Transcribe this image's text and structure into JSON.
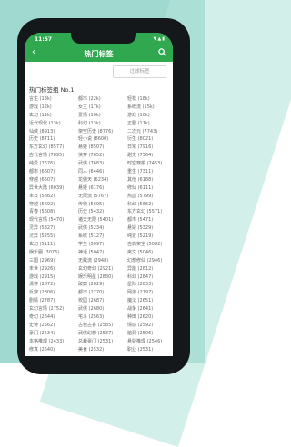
{
  "status": {
    "time": "11:57"
  },
  "appbar": {
    "title": "热门标签"
  },
  "filter": {
    "placeholder": "过滤标签"
  },
  "group": {
    "title": "热门标签组 No.1"
  },
  "tags": [
    [
      "言生 (13k)",
      "都市 (22k)",
      "轻松 (18k)"
    ],
    [
      "游戏 (12k)",
      "女主 (17k)",
      "系统流 (15k)"
    ],
    [
      "玄幻 (11k)",
      "爱情 (10k)",
      "游戏 (10k)"
    ],
    [
      "近代现代 (13k)",
      "科幻 (13k)",
      "正剧 (11k)"
    ],
    [
      "仙侠 (8913)",
      "架空历史 (8776)",
      "二次元 (7743)"
    ],
    [
      "历史 (8711)",
      "轻小说 (8600)",
      "衍生 (8021)"
    ],
    [
      "东方玄幻 (8577)",
      "悬疑 (8507)",
      "日常 (7916)"
    ],
    [
      "古代言情 (7895)",
      "快穿 (7652)",
      "甜文 (7564)"
    ],
    [
      "纯爱 (7676)",
      "武侠 (7683)",
      "时空穿梭 (7453)"
    ],
    [
      "都市 (6607)",
      "同人 (6446)",
      "重生 (7311)"
    ],
    [
      "穿越 (6507)",
      "龙傲天 (6234)",
      "其他 (6188)"
    ],
    [
      "异世大陆 (6039)",
      "悬疑 (6176)",
      "修仙 (6111)"
    ],
    [
      "末日 (5882)",
      "无限流 (5767)",
      "热血 (5799)"
    ],
    [
      "穿越 (5692)",
      "传统 (5695)",
      "科幻 (5662)"
    ],
    [
      "青春 (5608)",
      "历史 (5432)",
      "东方玄幻 (5571)"
    ],
    [
      "现代言情 (5470)",
      "诸天无限 (5401)",
      "都市 (5471)"
    ],
    [
      "灵异 (5327)",
      "武侠 (5234)",
      "悬疑 (5329)"
    ],
    [
      "灵异 (5255)",
      "系统 (5127)",
      "纯爱 (5219)"
    ],
    [
      "玄幻 (5111)",
      "学生 (5097)",
      "古典架空 (5082)"
    ],
    [
      "娱乐圈 (3076)",
      "神话 (5047)",
      "爽文 (5046)"
    ],
    [
      "三国 (2969)",
      "无敌流 (2948)",
      "幻想修仙 (2946)"
    ],
    [
      "末世 (2926)",
      "玄幻奇幻 (2921)",
      "异能 (2812)"
    ],
    [
      "游戏 (2915)",
      "娱乐明星 (2880)",
      "科幻 (2847)"
    ],
    [
      "清穿 (2872)",
      "破案 (2829)",
      "星际 (2833)"
    ],
    [
      "反穿 (2806)",
      "都市 (2770)",
      "网游 (2797)"
    ],
    [
      "剧情 (2787)",
      "校园 (2687)",
      "魔法 (2651)"
    ],
    [
      "玄幻言情 (2752)",
      "武侠 (2680)",
      "战争 (2641)"
    ],
    [
      "奇幻 (2644)",
      "宅斗 (2563)",
      "种田 (2620)"
    ],
    [
      "史诗 (2562)",
      "古色古香 (2585)",
      "情感 (2592)"
    ],
    [
      "豪门 (2534)",
      "武侠幻想 (2537)",
      "脑洞 (2506)"
    ],
    [
      "本格推理 (2433)",
      "总裁豪门 (2531)",
      "悬疑推理 (2546)"
    ],
    [
      "修真 (2540)",
      "美食 (2532)",
      "职业 (2531)"
    ]
  ]
}
